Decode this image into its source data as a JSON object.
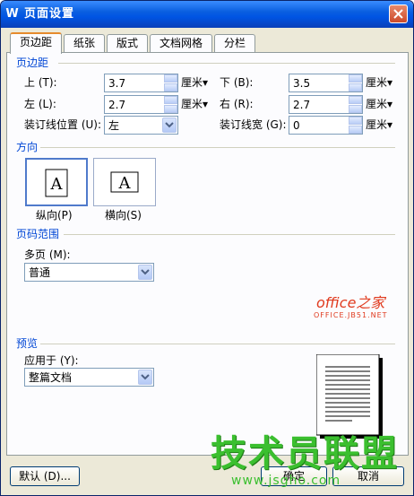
{
  "window": {
    "title": "页面设置",
    "app_icon": "W"
  },
  "tabs": [
    {
      "label": "页边距",
      "active": true
    },
    {
      "label": "纸张"
    },
    {
      "label": "版式"
    },
    {
      "label": "文档网格"
    },
    {
      "label": "分栏"
    }
  ],
  "margins": {
    "section": "页边距",
    "top": {
      "label": "上 (T):",
      "value": "3.7",
      "unit": "厘米▾"
    },
    "bottom": {
      "label": "下 (B):",
      "value": "3.5",
      "unit": "厘米▾"
    },
    "left": {
      "label": "左 (L):",
      "value": "2.7",
      "unit": "厘米▾"
    },
    "right": {
      "label": "右 (R):",
      "value": "2.7",
      "unit": "厘米▾"
    },
    "gutter_pos": {
      "label": "装订线位置 (U):",
      "value": "左"
    },
    "gutter": {
      "label": "装订线宽 (G):",
      "value": "0",
      "unit": "厘米▾"
    }
  },
  "orientation": {
    "section": "方向",
    "glyph": "A",
    "portrait": "纵向(P)",
    "landscape": "横向(S)",
    "selected": "portrait"
  },
  "pages": {
    "section": "页码范围",
    "label": "多页 (M):",
    "value": "普通"
  },
  "preview": {
    "section": "预览",
    "apply_label": "应用于 (Y):",
    "apply_value": "整篇文档"
  },
  "buttons": {
    "default": "默认 (D)...",
    "ok": "确定",
    "cancel": "取消"
  },
  "watermarks": {
    "site": "office之家",
    "site_url": "OFFICE.JB51.NET",
    "brand": "技术员联盟",
    "brand_url": "www.jsgho.com"
  },
  "colors": {
    "accent": "#0046d5",
    "titlebar": "#0054e3",
    "tab_highlight": "#e68b2c"
  }
}
